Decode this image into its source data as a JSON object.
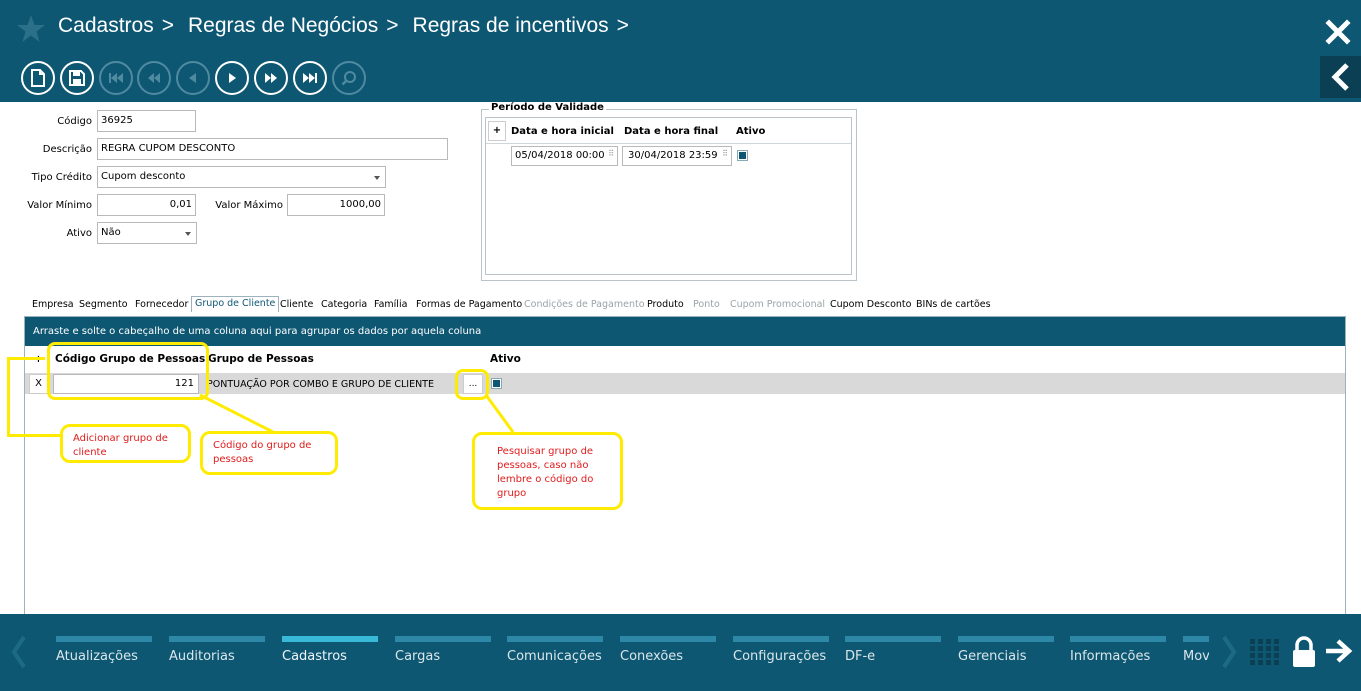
{
  "header": {
    "breadcrumb": [
      "Cadastros",
      "Regras de Negócios",
      "Regras de incentivos"
    ],
    "separator": ">"
  },
  "toolbar": {
    "buttons": [
      {
        "name": "new-document",
        "enabled": true
      },
      {
        "name": "save",
        "enabled": true
      },
      {
        "name": "first-record",
        "enabled": false
      },
      {
        "name": "previous-page",
        "enabled": false
      },
      {
        "name": "previous-record",
        "enabled": false
      },
      {
        "name": "next-record",
        "enabled": true
      },
      {
        "name": "next-page",
        "enabled": true
      },
      {
        "name": "last-record",
        "enabled": true
      },
      {
        "name": "search",
        "enabled": false
      }
    ]
  },
  "form": {
    "codigo_label": "Código",
    "codigo_value": "36925",
    "descricao_label": "Descrição",
    "descricao_value": "REGRA CUPOM DESCONTO",
    "tipo_credito_label": "Tipo Crédito",
    "tipo_credito_value": "Cupom desconto",
    "valor_minimo_label": "Valor Mínimo",
    "valor_minimo_value": "0,01",
    "valor_maximo_label": "Valor Máximo",
    "valor_maximo_value": "1000,00",
    "ativo_label": "Ativo",
    "ativo_value": "Não"
  },
  "periodo": {
    "title": "Período de Validade",
    "add_label": "+",
    "columns": [
      "Data e hora inicial",
      "Data e hora final",
      "Ativo"
    ],
    "rows": [
      {
        "inicial": "05/04/2018 00:00",
        "final": "30/04/2018 23:59",
        "ativo": true
      }
    ]
  },
  "tabs": [
    {
      "label": "Empresa",
      "state": "normal"
    },
    {
      "label": "Segmento",
      "state": "normal"
    },
    {
      "label": "Fornecedor",
      "state": "normal"
    },
    {
      "label": "Grupo de Cliente",
      "state": "selected"
    },
    {
      "label": "Cliente",
      "state": "normal"
    },
    {
      "label": "Categoria",
      "state": "normal"
    },
    {
      "label": "Família",
      "state": "normal"
    },
    {
      "label": "Formas de Pagamento",
      "state": "normal"
    },
    {
      "label": "Condições de Pagamento",
      "state": "disabled"
    },
    {
      "label": "Produto",
      "state": "normal"
    },
    {
      "label": "Ponto",
      "state": "disabled"
    },
    {
      "label": "Cupom Promocional",
      "state": "disabled"
    },
    {
      "label": "Cupom Desconto",
      "state": "normal"
    },
    {
      "label": "BINs de cartões",
      "state": "normal"
    }
  ],
  "grid": {
    "group_hint": "Arraste e solte o cabeçalho de uma coluna aqui para agrupar os dados por aquela coluna",
    "add_label": "+",
    "columns": [
      "Código Grupo de Pessoas",
      "Grupo de Pessoas",
      "Ativo"
    ],
    "rows": [
      {
        "remove_label": "X",
        "codigo": "121",
        "grupo": "PONTUAÇÃO POR COMBO E GRUPO DE CLIENTE",
        "lookup_label": "...",
        "ativo": true
      }
    ]
  },
  "annotations": {
    "adicionar": "Adicionar grupo de cliente",
    "codigo": "Código do grupo de pessoas",
    "pesquisar": "Pesquisar grupo de pessoas, caso não lembre o código do grupo"
  },
  "bottom_nav": {
    "items": [
      {
        "label": "Atualizações",
        "selected": false
      },
      {
        "label": "Auditorias",
        "selected": false
      },
      {
        "label": "Cadastros",
        "selected": true
      },
      {
        "label": "Cargas",
        "selected": false
      },
      {
        "label": "Comunicações",
        "selected": false
      },
      {
        "label": "Conexões",
        "selected": false
      },
      {
        "label": "Configurações",
        "selected": false
      },
      {
        "label": "DF-e",
        "selected": false
      },
      {
        "label": "Gerenciais",
        "selected": false
      },
      {
        "label": "Informações",
        "selected": false
      },
      {
        "label": "Mov",
        "selected": false
      }
    ]
  },
  "colors": {
    "primary": "#0e5773",
    "accent": "#38b9d8",
    "highlight": "#ffeb00",
    "annotation_text": "#e01b1b"
  }
}
